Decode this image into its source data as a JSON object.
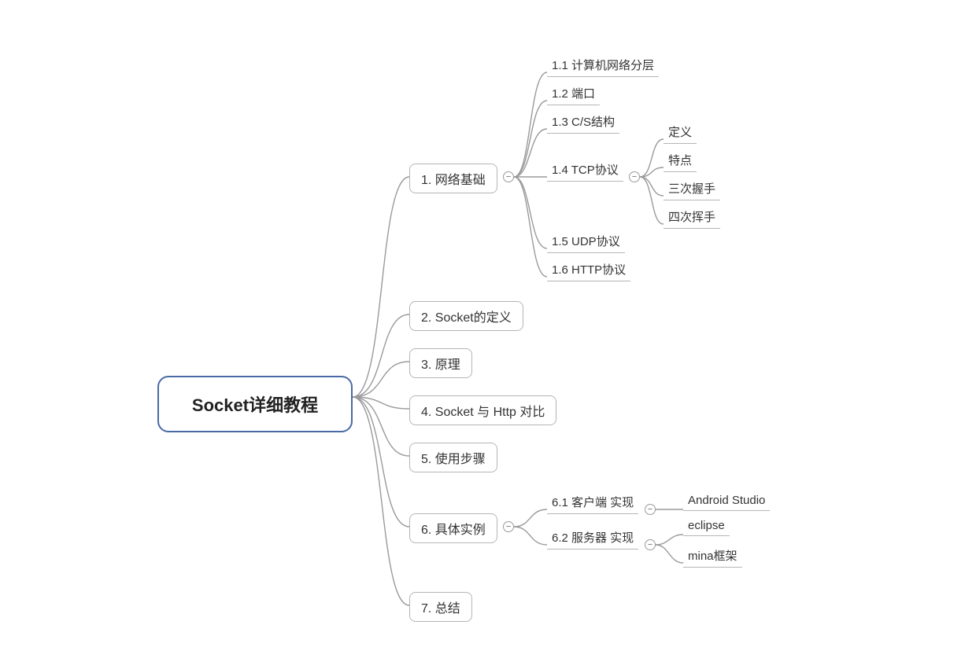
{
  "root": {
    "label": "Socket详细教程"
  },
  "level1": [
    {
      "id": "n1",
      "label": "1. 网络基础"
    },
    {
      "id": "n2",
      "label": "2. Socket的定义"
    },
    {
      "id": "n3",
      "label": "3. 原理"
    },
    {
      "id": "n4",
      "label": "4. Socket 与 Http 对比"
    },
    {
      "id": "n5",
      "label": "5. 使用步骤"
    },
    {
      "id": "n6",
      "label": "6. 具体实例"
    },
    {
      "id": "n7",
      "label": "7. 总结"
    }
  ],
  "n1_children": [
    {
      "id": "n1_1",
      "label": "1.1 计算机网络分层"
    },
    {
      "id": "n1_2",
      "label": "1.2 端口"
    },
    {
      "id": "n1_3",
      "label": "1.3 C/S结构"
    },
    {
      "id": "n1_4",
      "label": "1.4 TCP协议"
    },
    {
      "id": "n1_5",
      "label": "1.5 UDP协议"
    },
    {
      "id": "n1_6",
      "label": "1.6 HTTP协议"
    }
  ],
  "n1_4_children": [
    {
      "id": "tcp_def",
      "label": "定义"
    },
    {
      "id": "tcp_feat",
      "label": "特点"
    },
    {
      "id": "tcp_hand",
      "label": "三次握手"
    },
    {
      "id": "tcp_wave",
      "label": "四次挥手"
    }
  ],
  "n6_children": [
    {
      "id": "n6_1",
      "label": "6.1 客户端 实现"
    },
    {
      "id": "n6_2",
      "label": "6.2 服务器 实现"
    }
  ],
  "n6_1_children": [
    {
      "id": "as",
      "label": "Android Studio"
    }
  ],
  "n6_2_children": [
    {
      "id": "ecl",
      "label": "eclipse"
    },
    {
      "id": "mina",
      "label": "mina框架"
    }
  ],
  "collapse_symbol": "−"
}
